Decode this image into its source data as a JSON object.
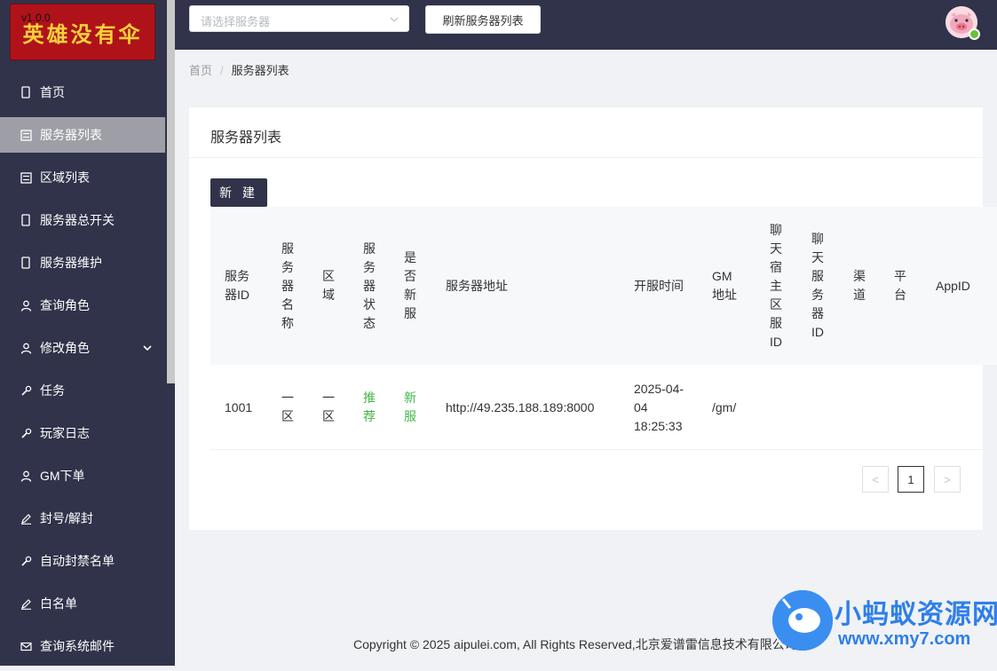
{
  "app": {
    "version": "v1.0.0",
    "logo_text": "英雄没有伞"
  },
  "sidebar": {
    "items": [
      {
        "label": "首页",
        "icon": "phone-icon"
      },
      {
        "label": "服务器列表",
        "icon": "list-icon",
        "active": true
      },
      {
        "label": "区域列表",
        "icon": "list-icon"
      },
      {
        "label": "服务器总开关",
        "icon": "phone-icon"
      },
      {
        "label": "服务器维护",
        "icon": "phone-icon"
      },
      {
        "label": "查询角色",
        "icon": "user-icon"
      },
      {
        "label": "修改角色",
        "icon": "user-icon",
        "has_submenu": true
      },
      {
        "label": "任务",
        "icon": "wrench-icon"
      },
      {
        "label": "玩家日志",
        "icon": "wrench-icon"
      },
      {
        "label": "GM下单",
        "icon": "user-icon"
      },
      {
        "label": "封号/解封",
        "icon": "edit-icon"
      },
      {
        "label": "自动封禁名单",
        "icon": "wrench-icon"
      },
      {
        "label": "白名单",
        "icon": "edit-icon"
      },
      {
        "label": "查询系统邮件",
        "icon": "mail-icon"
      }
    ]
  },
  "header": {
    "server_select_placeholder": "请选择服务器",
    "refresh_label": "刷新服务器列表"
  },
  "breadcrumb": {
    "home": "首页",
    "separator": "/",
    "current": "服务器列表"
  },
  "card": {
    "title": "服务器列表",
    "new_button": "新 建"
  },
  "table": {
    "columns": [
      "服务器ID",
      "服务器名称",
      "区域",
      "服务器状态",
      "是否新服",
      "服务器地址",
      "开服时间",
      "GM地址",
      "聊天宿主区服ID",
      "聊天服务器ID",
      "渠道",
      "平台",
      "AppID"
    ],
    "rows": [
      {
        "server_id": "1001",
        "server_name": "一区",
        "region": "一区",
        "status": "推荐",
        "is_new": "新服",
        "address": "http://49.235.188.189:8000",
        "open_time": "2025-04-04 18:25:33",
        "gm_address": "/gm/",
        "chat_host_id": "",
        "chat_server_id": "",
        "channel": "",
        "platform": "",
        "app_id": ""
      }
    ]
  },
  "pagination": {
    "prev": "<",
    "current": "1",
    "next": ">"
  },
  "footer": {
    "copyright": "Copyright © 2025 aipulei.com, All Rights Reserved,北京爱谱雷信息技术有限公司"
  },
  "watermark": {
    "title": "小蚂蚁资源网",
    "url": "www.xmy7.com"
  },
  "colors": {
    "sidebar_bg": "#30334a",
    "active_item_bg": "#9e9fa6",
    "page_bg": "#f0f2f5",
    "status_green": "#44b549",
    "logo_red": "#b0121a"
  }
}
